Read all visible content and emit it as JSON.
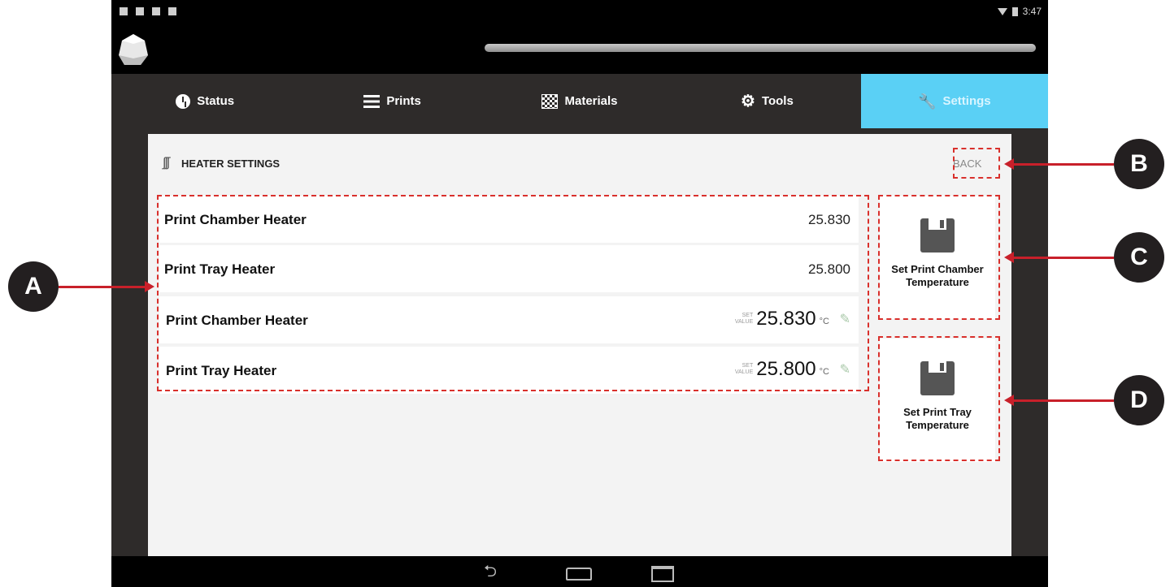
{
  "status_bar": {
    "time": "3:47"
  },
  "tabs": [
    {
      "label": "Status",
      "icon": "clock-icon"
    },
    {
      "label": "Prints",
      "icon": "list-icon"
    },
    {
      "label": "Materials",
      "icon": "checkerboard-icon"
    },
    {
      "label": "Tools",
      "icon": "gear-icon"
    },
    {
      "label": "Settings",
      "icon": "wrench-icon",
      "active": true
    }
  ],
  "accent_color": "#5ad0f5",
  "panel": {
    "title": "HEATER SETTINGS",
    "back_label": "BACK"
  },
  "readings": [
    {
      "label": "Print Chamber Heater",
      "value": "25.830"
    },
    {
      "label": "Print Tray Heater",
      "value": "25.800"
    }
  ],
  "setpoints": [
    {
      "label": "Print Chamber Heater",
      "set_label_1": "SET",
      "set_label_2": "VALUE",
      "value": "25.830",
      "unit": "°C"
    },
    {
      "label": "Print Tray Heater",
      "set_label_1": "SET",
      "set_label_2": "VALUE",
      "value": "25.800",
      "unit": "°C"
    }
  ],
  "actions": {
    "set_chamber_line1": "Set Print Chamber",
    "set_chamber_line2": "Temperature",
    "set_tray_line1": "Set Print Tray",
    "set_tray_line2": "Temperature"
  },
  "callouts": {
    "a": "A",
    "b": "B",
    "c": "C",
    "d": "D"
  }
}
